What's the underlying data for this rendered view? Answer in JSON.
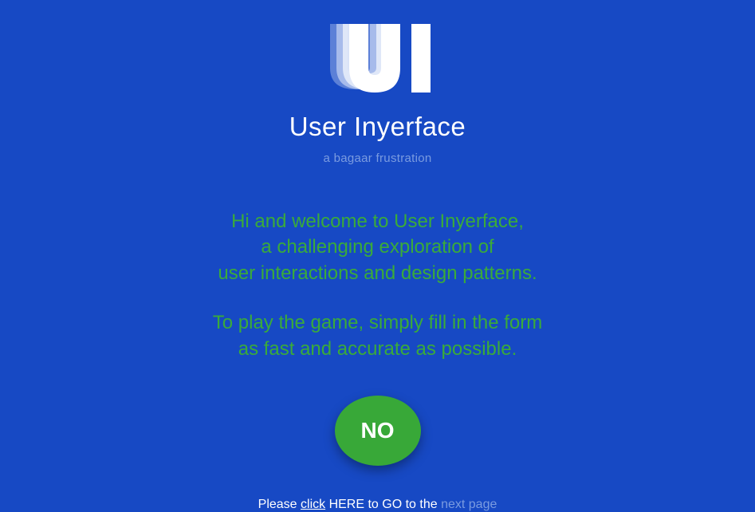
{
  "brand": {
    "title": "User Inyerface",
    "subtitle": "a bagaar frustration"
  },
  "welcome": {
    "line1": "Hi and welcome to User Inyerface,",
    "line2": "a challenging exploration of",
    "line3": "user interactions and design patterns."
  },
  "instruction": {
    "line1": "To play the game, simply fill in the form",
    "line2": "as fast and accurate as possible."
  },
  "button": {
    "label": "NO"
  },
  "bottom": {
    "please": "Please ",
    "click": "click",
    "here_to_go": " HERE to GO to the ",
    "next_page": "next page"
  },
  "colors": {
    "background": "#1749C4",
    "accent_green": "#38a838",
    "text_green": "#3aab3a",
    "muted": "#7a9be0"
  }
}
